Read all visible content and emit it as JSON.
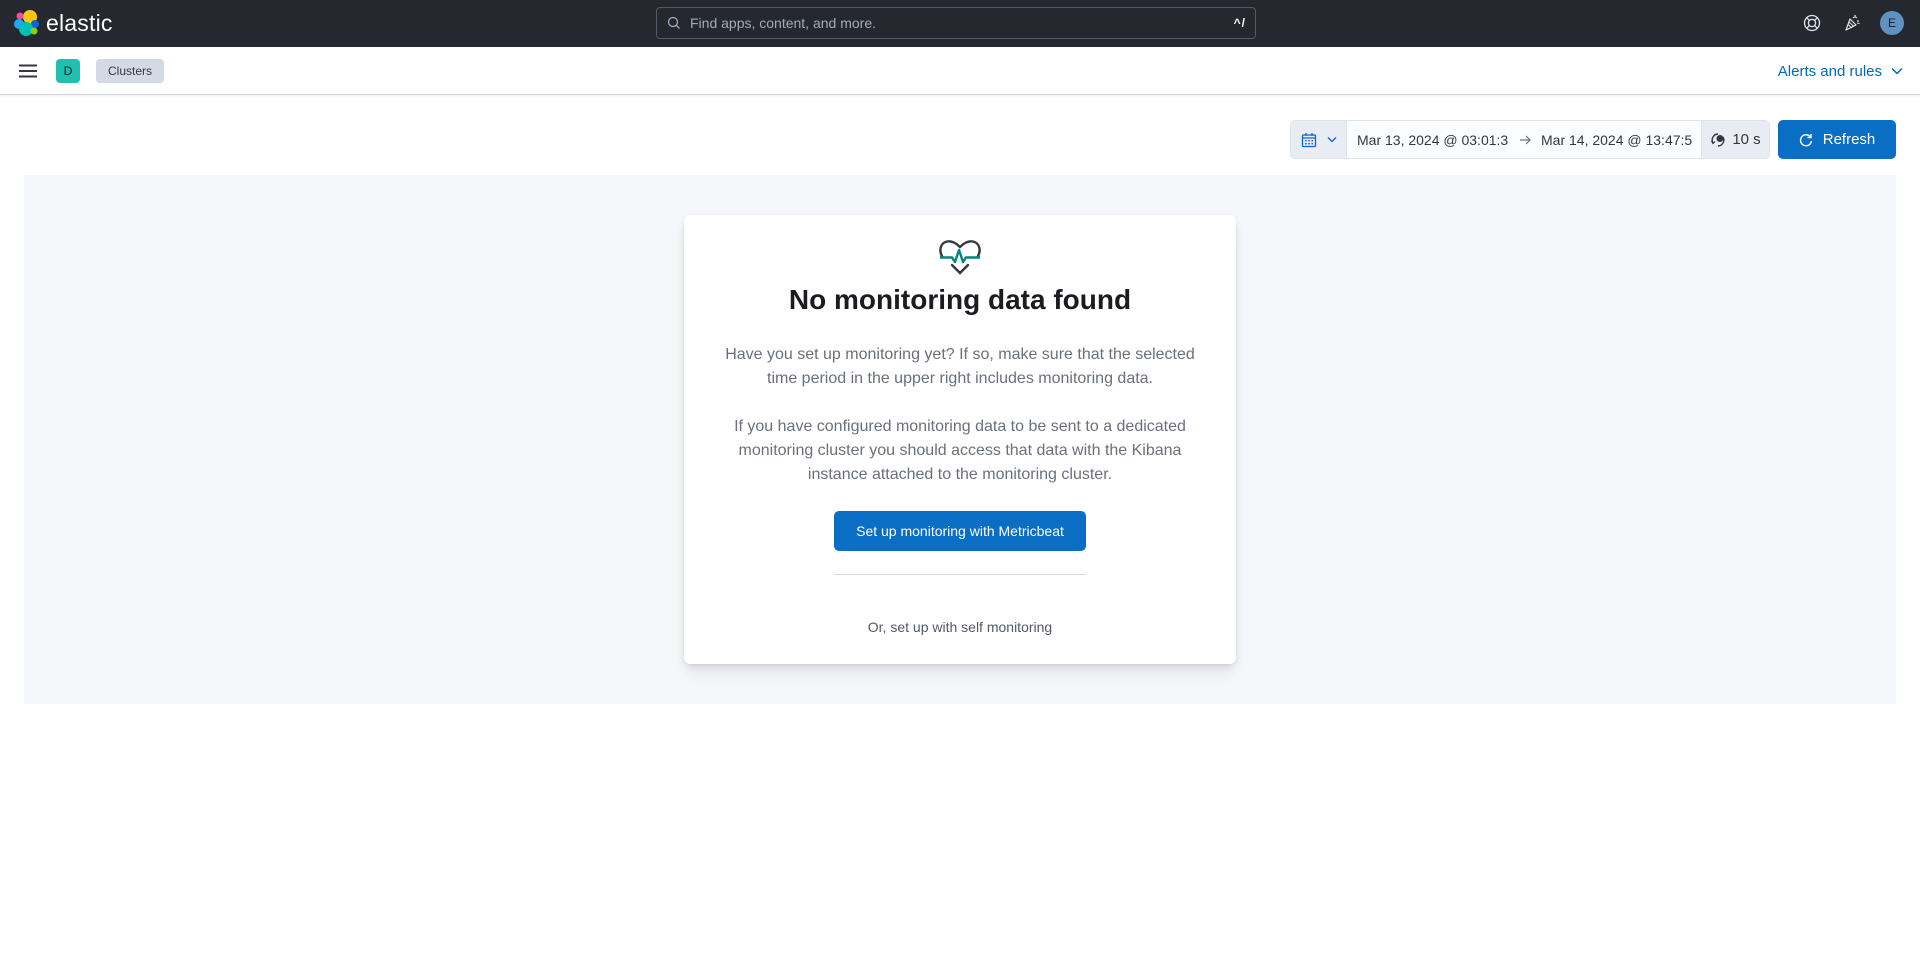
{
  "header": {
    "brand": "elastic",
    "search": {
      "placeholder": "Find apps, content, and more.",
      "value": "",
      "shortcut": "^/"
    },
    "icons": [
      "help-icon",
      "whats-new-icon"
    ],
    "user_initial": "E",
    "colors": {
      "background": "#25282f",
      "user_avatar": "#6092c0"
    }
  },
  "subheader": {
    "space_initial": "D",
    "breadcrumbs": [
      {
        "label": "Clusters"
      }
    ],
    "alerts_menu_label": "Alerts and rules",
    "colors": {
      "space_avatar": "#20c0b0",
      "link": "#006bb8"
    }
  },
  "date_picker": {
    "start": "Mar 13, 2024 @ 03:01:3",
    "end": "Mar 14, 2024 @ 13:47:5",
    "refresh_interval": "10 s",
    "refresh_label": "Refresh"
  },
  "empty_state": {
    "icon": "heartbeat-icon",
    "title": "No monitoring data found",
    "paragraphs": [
      "Have you set up monitoring yet? If so, make sure that the selected time period in the upper right includes monitoring data.",
      "If you have configured monitoring data to be sent to a dedicated monitoring cluster you should access that data with the Kibana instance attached to the monitoring cluster."
    ],
    "primary_action": "Set up monitoring with Metricbeat",
    "secondary_action": "Or, set up with self monitoring",
    "colors": {
      "primary": "#0b6ec5",
      "icon_accent": "#00857a"
    }
  }
}
